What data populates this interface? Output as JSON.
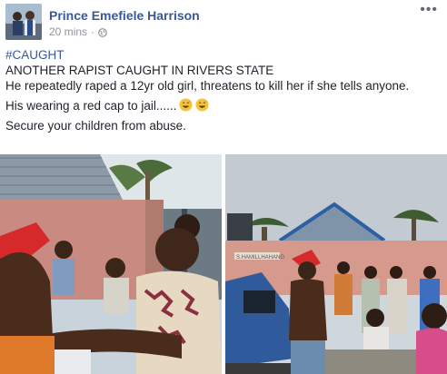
{
  "post": {
    "author": "Prince Emefiele Harrison",
    "time": "20 mins",
    "dot": "·",
    "hashtag": "#CAUGHT",
    "line1": "ANOTHER RAPIST CAUGHT IN RIVERS STATE",
    "line2": "He repeatedly raped a 12yr old girl, threatens to kill her if she tells anyone.",
    "line3": "His wearing a red cap to jail......",
    "line4": "Secure your children from abuse.",
    "more_icon": "more-options-icon",
    "privacy_icon": "globe-icon",
    "emoji_icon": "grinning-sweat-emoji"
  },
  "photos": {
    "right_sign": "S.HAMILLHAHANG"
  },
  "colors": {
    "link": "#385898",
    "text": "#1d2129",
    "meta": "#90949c"
  }
}
